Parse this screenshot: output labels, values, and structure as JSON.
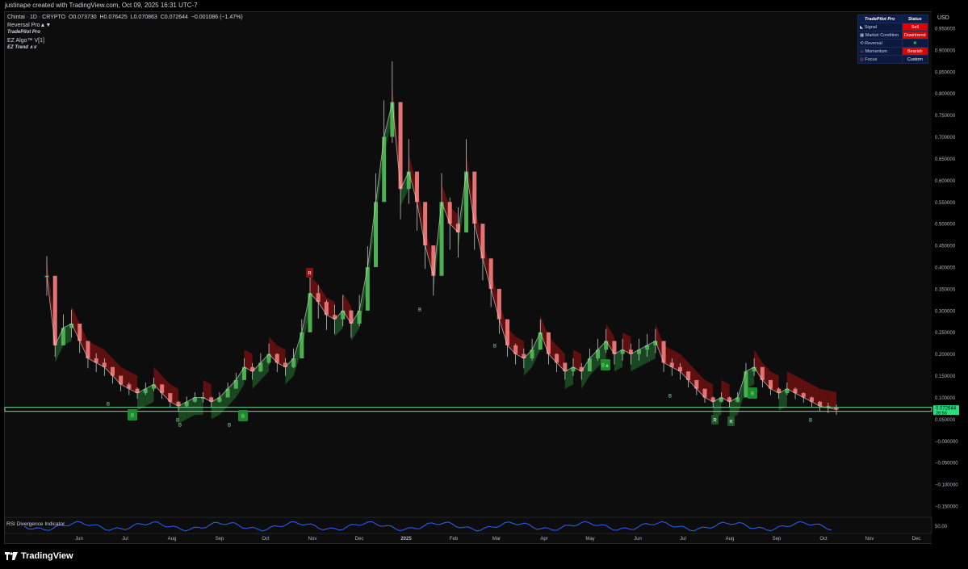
{
  "header": {
    "text": "justinape created with TradingView.com, Oct 09, 2025 16:31 UTC-7"
  },
  "legend": {
    "symbol_line": "Chintai · 1D · CRYPTO",
    "open": "O0.073730",
    "high": "H0.076425",
    "low": "L0.070863",
    "close": "C0.072644",
    "change": "−0.001086 (−1.47%)",
    "indicators": [
      "Reversal Pro▲▼",
      "TradePilot Pro",
      "EZ Algo™ V[1]",
      "EZ Trend ∧∨"
    ]
  },
  "status_table": {
    "header": [
      "TradePilot Pro",
      "Status"
    ],
    "rows": [
      {
        "icon": "signal-icon",
        "label": "Signal",
        "value": "Sell",
        "style": "red"
      },
      {
        "icon": "chart-icon",
        "label": "Market Condition",
        "value": "Downtrend",
        "style": "red"
      },
      {
        "icon": "reversal-icon",
        "label": "Reversal",
        "value": "✖",
        "style": "green"
      },
      {
        "icon": "fire-icon",
        "label": "Momentum",
        "value": "Bearish",
        "style": "red"
      },
      {
        "icon": "target-icon",
        "label": "Focus",
        "value": "Custom",
        "style": "plain"
      }
    ]
  },
  "colors": {
    "bull": "#4caf50",
    "bear": "#e57373",
    "price_tag": "#26e07f",
    "rsi": "#2962ff"
  },
  "rsi_label": "RSI Divergence Indicator",
  "rsi_axis_label": "50.00",
  "footer": {
    "brand": "TradingView"
  },
  "chart_data": {
    "type": "line",
    "currency": "USD",
    "last_price": "0.072644",
    "countdown": "28:56",
    "y_ticks": [
      "0.950000",
      "0.900000",
      "0.850000",
      "0.800000",
      "0.750000",
      "0.700000",
      "0.650000",
      "0.600000",
      "0.550000",
      "0.500000",
      "0.450000",
      "0.400000",
      "0.350000",
      "0.300000",
      "0.250000",
      "0.200000",
      "0.150000",
      "0.100000",
      "0.050000",
      "−0.000000",
      "−0.050000",
      "−0.100000",
      "−0.150000"
    ],
    "ylim": [
      -0.17,
      0.96
    ],
    "x_labels": [
      "Jun",
      "Jul",
      "Aug",
      "Sep",
      "Oct",
      "Nov",
      "Dec",
      "2025",
      "Feb",
      "Mar",
      "Apr",
      "May",
      "Jun",
      "Jul",
      "Aug",
      "Sep",
      "Oct",
      "Nov",
      "Dec"
    ],
    "price_series": [
      [
        0,
        0.38
      ],
      [
        1,
        0.22
      ],
      [
        2,
        0.26
      ],
      [
        3,
        0.27
      ],
      [
        4,
        0.23
      ],
      [
        5,
        0.19
      ],
      [
        6,
        0.18
      ],
      [
        7,
        0.17
      ],
      [
        8,
        0.15
      ],
      [
        9,
        0.13
      ],
      [
        10,
        0.12
      ],
      [
        11,
        0.11
      ],
      [
        12,
        0.12
      ],
      [
        13,
        0.13
      ],
      [
        14,
        0.11
      ],
      [
        15,
        0.09
      ],
      [
        16,
        0.08
      ],
      [
        17,
        0.09
      ],
      [
        18,
        0.1
      ],
      [
        19,
        0.1
      ],
      [
        20,
        0.09
      ],
      [
        21,
        0.1
      ],
      [
        22,
        0.12
      ],
      [
        23,
        0.14
      ],
      [
        24,
        0.17
      ],
      [
        25,
        0.16
      ],
      [
        26,
        0.18
      ],
      [
        27,
        0.2
      ],
      [
        28,
        0.18
      ],
      [
        29,
        0.17
      ],
      [
        30,
        0.19
      ],
      [
        31,
        0.25
      ],
      [
        32,
        0.34
      ],
      [
        33,
        0.32
      ],
      [
        34,
        0.29
      ],
      [
        35,
        0.28
      ],
      [
        36,
        0.3
      ],
      [
        37,
        0.27
      ],
      [
        38,
        0.3
      ],
      [
        39,
        0.4
      ],
      [
        40,
        0.55
      ],
      [
        41,
        0.7
      ],
      [
        42,
        0.78
      ],
      [
        43,
        0.58
      ],
      [
        44,
        0.62
      ],
      [
        45,
        0.55
      ],
      [
        46,
        0.45
      ],
      [
        47,
        0.38
      ],
      [
        48,
        0.55
      ],
      [
        49,
        0.5
      ],
      [
        50,
        0.48
      ],
      [
        51,
        0.62
      ],
      [
        52,
        0.5
      ],
      [
        53,
        0.42
      ],
      [
        54,
        0.35
      ],
      [
        55,
        0.28
      ],
      [
        56,
        0.22
      ],
      [
        57,
        0.2
      ],
      [
        58,
        0.19
      ],
      [
        59,
        0.21
      ],
      [
        60,
        0.25
      ],
      [
        61,
        0.2
      ],
      [
        62,
        0.18
      ],
      [
        63,
        0.16
      ],
      [
        64,
        0.17
      ],
      [
        65,
        0.16
      ],
      [
        66,
        0.19
      ],
      [
        67,
        0.21
      ],
      [
        68,
        0.23
      ],
      [
        69,
        0.2
      ],
      [
        70,
        0.21
      ],
      [
        71,
        0.2
      ],
      [
        72,
        0.21
      ],
      [
        73,
        0.22
      ],
      [
        74,
        0.23
      ],
      [
        75,
        0.18
      ],
      [
        76,
        0.17
      ],
      [
        77,
        0.16
      ],
      [
        78,
        0.14
      ],
      [
        79,
        0.12
      ],
      [
        80,
        0.1
      ],
      [
        81,
        0.09
      ],
      [
        82,
        0.1
      ],
      [
        83,
        0.09
      ],
      [
        84,
        0.1
      ],
      [
        85,
        0.16
      ],
      [
        86,
        0.17
      ],
      [
        87,
        0.14
      ],
      [
        88,
        0.12
      ],
      [
        89,
        0.11
      ],
      [
        90,
        0.12
      ],
      [
        91,
        0.11
      ],
      [
        92,
        0.1
      ],
      [
        93,
        0.09
      ],
      [
        94,
        0.08
      ],
      [
        95,
        0.076
      ],
      [
        96,
        0.072
      ]
    ]
  },
  "signal_markers": {
    "reversal_labels": [
      "R",
      "R",
      "R"
    ],
    "buy_labels": [
      "B",
      "B",
      "B",
      "B",
      "B",
      "B",
      "B",
      "B",
      "B",
      "B",
      "B▲",
      "B"
    ]
  }
}
